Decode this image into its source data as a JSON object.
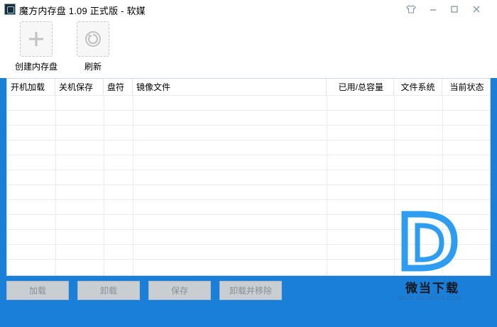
{
  "window": {
    "title": "魔方内存盘 1.09 正式版 - 软媒"
  },
  "titlebar": {
    "skin_icon": "tshirt-icon",
    "minimize_icon": "minimize-icon",
    "maximize_icon": "maximize-icon",
    "close_icon": "close-icon"
  },
  "toolbar": {
    "create": {
      "label": "创建内存盘",
      "icon": "plus-icon"
    },
    "refresh": {
      "label": "刷新",
      "icon": "refresh-icon"
    }
  },
  "table": {
    "columns": [
      "开机加载",
      "关机保存",
      "盘符",
      "镜像文件",
      "已用/总容量",
      "文件系统",
      "当前状态"
    ],
    "rows": []
  },
  "buttons": {
    "load": "加载",
    "unload": "卸载",
    "save": "保存",
    "unload_remove": "卸载并移除"
  },
  "watermark": {
    "text": "微当下载",
    "url": "WWW.WEIDOWN.COM",
    "brand_color": "#2e9cf0"
  }
}
